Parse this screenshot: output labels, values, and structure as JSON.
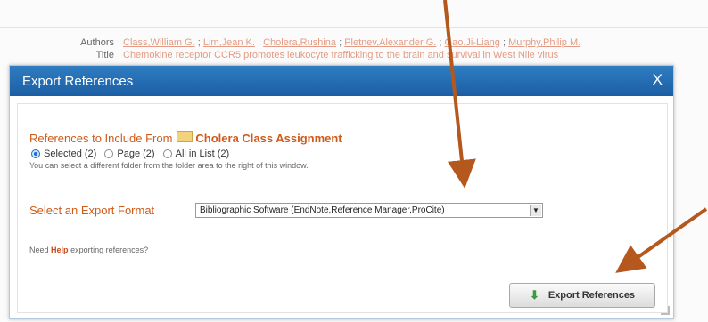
{
  "background": {
    "authors_label": "Authors",
    "authors": [
      "Class,William G.",
      "Lim,Jean K.",
      "Cholera,Rushina",
      "Pletnev,Alexander G.",
      "Gao,Ji-Liang",
      "Murphy,Philip M."
    ],
    "title_label": "Title",
    "title_text": "Chemokine receptor CCR5 promotes leukocyte trafficking to the brain and survival in West Nile virus"
  },
  "dialog": {
    "title": "Export References",
    "close_label": "X",
    "refs_heading": "References to Include From",
    "folder_name": "Cholera Class Assignment",
    "radio_options": [
      {
        "label": "Selected (2)",
        "checked": true
      },
      {
        "label": "Page (2)",
        "checked": false
      },
      {
        "label": "All in List (2)",
        "checked": false
      }
    ],
    "hint": "You can select a different folder from the folder area to the right of this window.",
    "format_label": "Select an Export Format",
    "format_value": "Bibliographic Software (EndNote,Reference Manager,ProCite)",
    "help_prefix": "Need",
    "help_link": "Help",
    "help_suffix": "exporting references?",
    "export_button": "Export References"
  },
  "colors": {
    "titlebar": "#1c5ea3",
    "heading": "#cf5a1a",
    "annotation_arrow": "#b5581e"
  },
  "icons": [
    "folder-icon",
    "arrow-down-icon",
    "close-icon",
    "select-arrow-icon"
  ]
}
